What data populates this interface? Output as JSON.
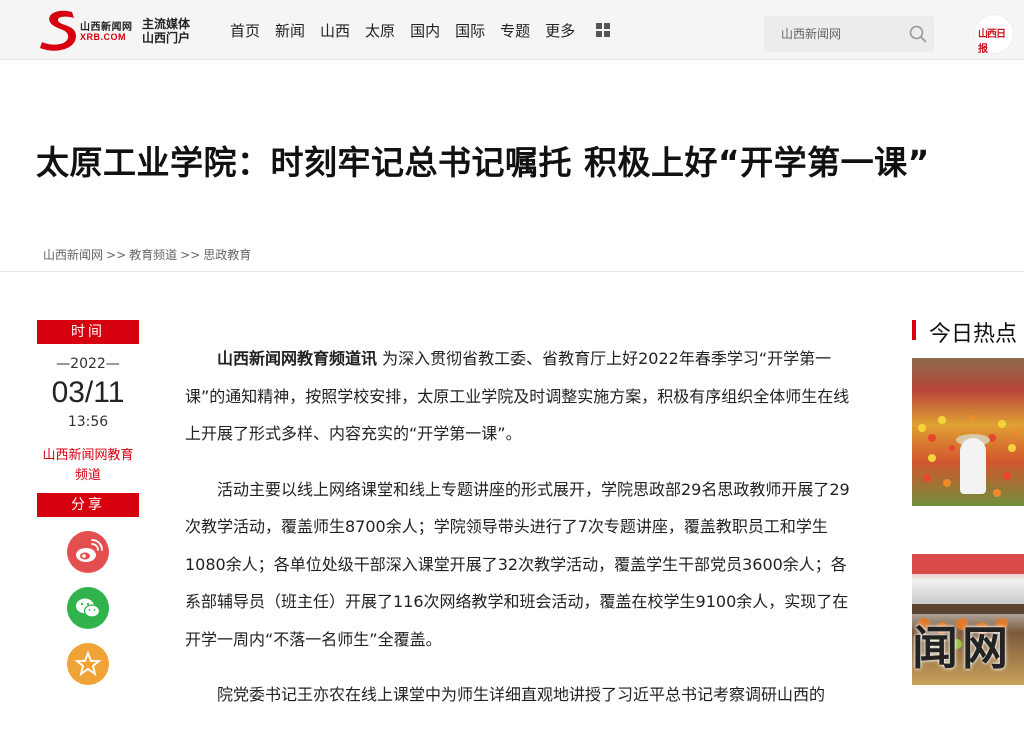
{
  "header": {
    "logo": {
      "name": "山西新闻网",
      "domain": "XRB.COM",
      "slogan_line1": "主流媒体",
      "slogan_line2": "山西门户"
    },
    "nav": [
      "首页",
      "新闻",
      "山西",
      "太原",
      "国内",
      "国际",
      "专题",
      "更多"
    ],
    "more_icon": "grid-icon",
    "search": {
      "placeholder": "山西新闻网",
      "icon": "search-icon"
    },
    "paper_logo": "山西日报"
  },
  "article": {
    "title": "太原工业学院：时刻牢记总书记嘱托 积极上好“开学第一课”",
    "breadcrumb": [
      "山西新闻网",
      "教育频道",
      "思政教育"
    ],
    "breadcrumb_separator": ">>",
    "lead_source": "山西新闻网教育频道讯",
    "paragraphs": [
      "为深入贯彻省教工委、省教育厅上好2022年春季学习“开学第一课”的通知精神，按照学校安排，太原工业学院及时调整实施方案，积极有序组织全体师生在线上开展了形式多样、内容充实的“开学第一课”。",
      "活动主要以线上网络课堂和线上专题讲座的形式展开，学院思政部29名思政教师开展了29次教学活动，覆盖师生8700余人；学院领导带头进行了7次专题讲座，覆盖教职员工和学生1080余人；各单位处级干部深入课堂开展了32次教学活动，覆盖学生干部党员3600余人；各系部辅导员（班主任）开展了116次网络教学和班会活动，覆盖在校学生9100余人，实现了在开学一周内“不落一名师生”全覆盖。",
      "院党委书记王亦农在线上课堂中为师生详细直观地讲授了习近平总书记考察调研山西的"
    ]
  },
  "sidebar": {
    "time_label": "时间",
    "year": "—2022—",
    "date": "03/11",
    "time": "13:56",
    "source": "山西新闻网教育频道",
    "share_label": "分享",
    "share": [
      {
        "name": "weibo-icon",
        "color": "#e34f4f"
      },
      {
        "name": "wechat-icon",
        "color": "#2fb34a"
      },
      {
        "name": "favorite-icon",
        "color": "#f0a437"
      }
    ]
  },
  "hot": {
    "title": "今日热点",
    "watermark": "闻网"
  },
  "colors": {
    "accent": "#d7000f"
  }
}
